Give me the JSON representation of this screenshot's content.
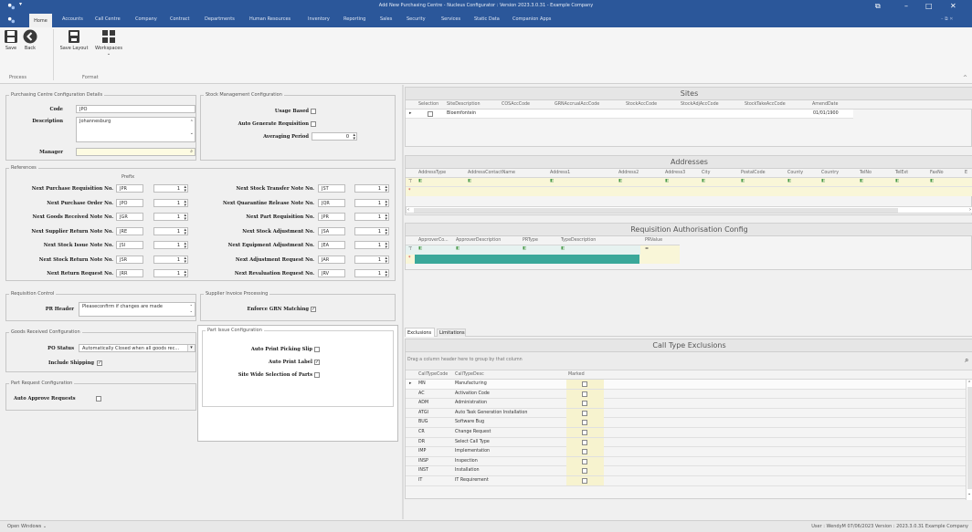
{
  "window": {
    "title": "Add New Purchasing Centre - Nucleus Configurator : Version 2023.3.0.31 - Example Company"
  },
  "menu": {
    "items": [
      "Home",
      "Accounts",
      "Call Centre",
      "Company",
      "Contract",
      "Departments",
      "Human Resources",
      "Inventory",
      "Reporting",
      "Sales",
      "Security",
      "Services",
      "Static Data",
      "Companion Apps"
    ]
  },
  "ribbon": {
    "save": "Save",
    "back": "Back",
    "save_layout": "Save Layout",
    "workspaces": "Workspaces",
    "group_process": "Process",
    "group_format": "Format"
  },
  "pcd": {
    "title": "Purchasing Centre Configuration Details",
    "code_label": "Code",
    "code_value": "JPO",
    "description_label": "Description",
    "description_value": "Johannesburg",
    "manager_label": "Manager",
    "manager_value": ""
  },
  "smc": {
    "title": "Stock Management Configuration",
    "usage_based": "Usage Based",
    "auto_generate": "Auto Generate Requisition",
    "averaging_period": "Averaging Period",
    "averaging_value": "0"
  },
  "references": {
    "title": "References",
    "prefix_header": "Prefix",
    "left": [
      {
        "label": "Next Purchase Requisition No.",
        "prefix": "JPR",
        "num": "1"
      },
      {
        "label": "Next Purchase Order No.",
        "prefix": "JPO",
        "num": "1"
      },
      {
        "label": "Next Goods Received Note No.",
        "prefix": "JGR",
        "num": "1"
      },
      {
        "label": "Next Supplier Return Note No.",
        "prefix": "JRE",
        "num": "1"
      },
      {
        "label": "Next Stock Issue Note No.",
        "prefix": "JSI",
        "num": "1"
      },
      {
        "label": "Next Stock Return Note No.",
        "prefix": "JSR",
        "num": "1"
      },
      {
        "label": "Next Return Request No.",
        "prefix": "JRR",
        "num": "1"
      }
    ],
    "right": [
      {
        "label": "Next Stock Transfer Note No.",
        "prefix": "JST",
        "num": "1"
      },
      {
        "label": "Next Quarantine Release Note No.",
        "prefix": "JQR",
        "num": "1"
      },
      {
        "label": "Next Part Requisition No.",
        "prefix": "JPR",
        "num": "1"
      },
      {
        "label": "Next Stock Adjustment No.",
        "prefix": "JSA",
        "num": "1"
      },
      {
        "label": "Next Equipment Adjustment No.",
        "prefix": "JEA",
        "num": "1"
      },
      {
        "label": "Next Adjustment Request No.",
        "prefix": "JAR",
        "num": "1"
      },
      {
        "label": "Next Revaluation Request No.",
        "prefix": "JRV",
        "num": "1"
      }
    ]
  },
  "requisition_control": {
    "title": "Requisition Control",
    "pr_header_label": "PR Header",
    "pr_header_value": "Pleaseconfirm if changes are made"
  },
  "supplier_invoice": {
    "title": "Supplier Invoice Processing",
    "enforce_grn": "Enforce GRN Matching",
    "enforce_grn_checked": "✓"
  },
  "goods_received": {
    "title": "Goods Received Configuration",
    "po_status_label": "PO Status",
    "po_status_value": "Automatically Closed when all goods rec...",
    "include_shipping": "Include Shipping",
    "include_shipping_checked": "✓"
  },
  "part_issue": {
    "title": "Part Issue Configuration",
    "auto_print_picking": "Auto Print Picking Slip",
    "auto_print_label": "Auto Print Label",
    "auto_print_label_checked": "✓",
    "site_wide": "Site Wide Selection of Parts"
  },
  "part_request": {
    "title": "Part Request Configuration",
    "auto_approve": "Auto Approve Requests"
  },
  "sites": {
    "title": "Sites",
    "headers": [
      "Selection",
      "SiteDescription",
      "COSAccCode",
      "GRNAccrualAccCode",
      "StockAccCode",
      "StockAdjAccCode",
      "StockTakeAccCode",
      "AmendDate"
    ],
    "row": {
      "description": "Bloemfontein",
      "amend_date": "01/01/1900"
    }
  },
  "addresses": {
    "title": "Addresses",
    "headers": [
      "AddressType",
      "AddressContactName",
      "Address1",
      "Address2",
      "Address3",
      "City",
      "PostalCode",
      "County",
      "Country",
      "TelNo",
      "TelExt",
      "FaxNo",
      "E"
    ]
  },
  "req_auth": {
    "title": "Requisition Authorisation Config",
    "headers": [
      "ApproverCo...",
      "ApproverDescription",
      "PRType",
      "TypeDescription",
      "PRValue"
    ],
    "filter_value": "="
  },
  "tabs": {
    "exclusions": "Exclusions",
    "limitations": "Limitations"
  },
  "call_type": {
    "title": "Call Type Exclusions",
    "group_hint": "Drag a column header here to group by that column",
    "headers": [
      "CallTypeCode",
      "CallTypeDesc",
      "Marked"
    ],
    "rows": [
      {
        "code": "MN",
        "desc": "Manufacturing"
      },
      {
        "code": "AC",
        "desc": "Activation Code"
      },
      {
        "code": "ADM",
        "desc": "Administration"
      },
      {
        "code": "ATGI",
        "desc": "Auto Task Generation Installation"
      },
      {
        "code": "BUG",
        "desc": "Software Bug"
      },
      {
        "code": "CR",
        "desc": "Change Request"
      },
      {
        "code": "DR",
        "desc": "Select Call Type"
      },
      {
        "code": "IMP",
        "desc": "Implementation"
      },
      {
        "code": "INSP",
        "desc": "Inspection"
      },
      {
        "code": "INST",
        "desc": "Installation"
      },
      {
        "code": "IT",
        "desc": "IT Requirement"
      }
    ]
  },
  "status": {
    "open_windows": "Open Windows ⌄",
    "right": "User : WendyM  07/06/2023  Version : 2023.3.0.31  Example Company"
  },
  "colors": {
    "brand": "#2b579a",
    "marked_cell": "#f7f3cf",
    "teal_row": "#3aa89a"
  }
}
